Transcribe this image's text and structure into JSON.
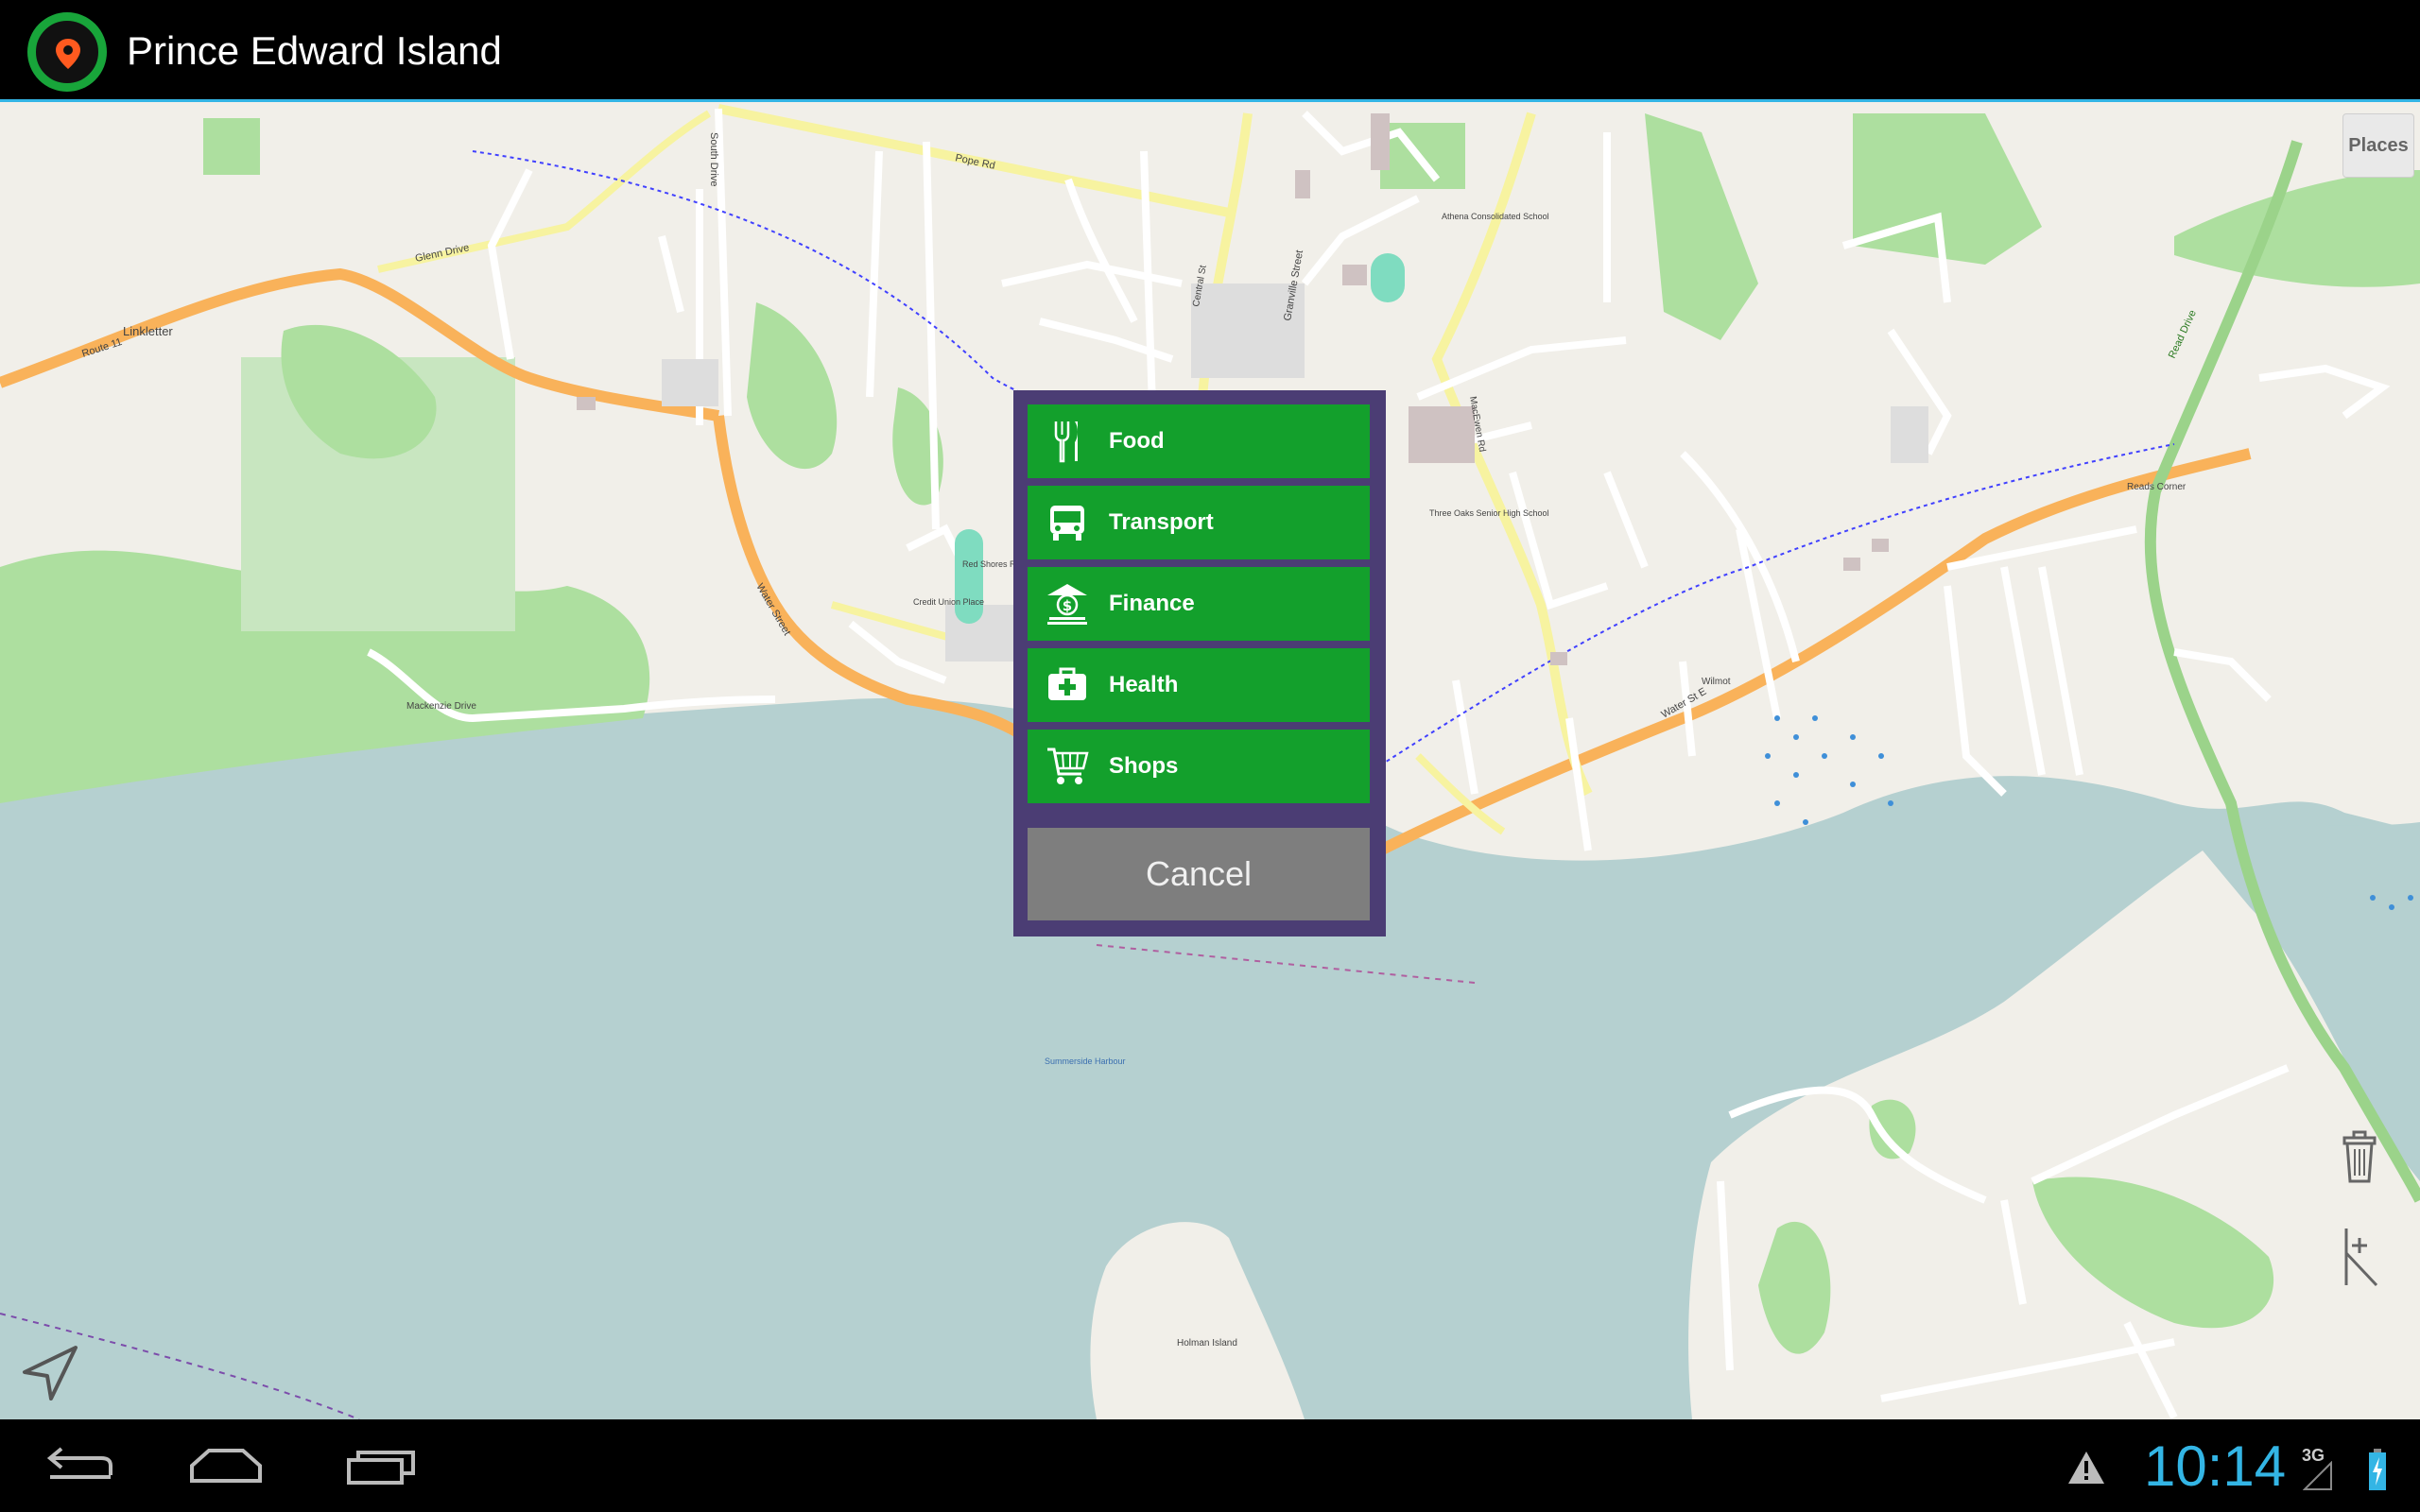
{
  "app": {
    "title": "Prince Edward Island",
    "icon": "map-pin-icon"
  },
  "map": {
    "places_button": "Places",
    "labels": {
      "linkletter": "Linkletter",
      "route11": "Route 11",
      "glenn": "Glenn Drive",
      "pope": "Pope Rd",
      "water_st_e": "Water St E",
      "water_street": "Water Street",
      "south_drive": "South Drive",
      "reads_corner": "Reads Corner",
      "holman_island": "Holman Island",
      "summerside_harbour": "Summerside Harbour",
      "athena": "Athena Consolidated School",
      "three_oaks": "Three Oaks Senior High School",
      "mackenzie": "Mackenzie Drive",
      "granville": "Granville Street",
      "credit_union": "Credit Union Place",
      "red_shores": "Red Shores Racetrack",
      "wilmot": "Wilmot",
      "mackinnon": "MacEwen Rd",
      "central": "Central St",
      "read_drive": "Read Drive"
    }
  },
  "dialog": {
    "items": [
      {
        "label": "Food",
        "icon": "fork-knife-icon"
      },
      {
        "label": "Transport",
        "icon": "bus-icon"
      },
      {
        "label": "Finance",
        "icon": "bank-icon"
      },
      {
        "label": "Health",
        "icon": "first-aid-kit-icon"
      },
      {
        "label": "Shops",
        "icon": "shopping-cart-icon"
      }
    ],
    "cancel_label": "Cancel"
  },
  "status": {
    "time": "10:14",
    "network": "3G"
  },
  "colors": {
    "accent": "#33b5e5",
    "menu_green": "#13a02c",
    "dialog_bg": "#4b3d74",
    "water": "#b5d0d0",
    "land": "#f1efe9",
    "park": "#addf9f"
  }
}
